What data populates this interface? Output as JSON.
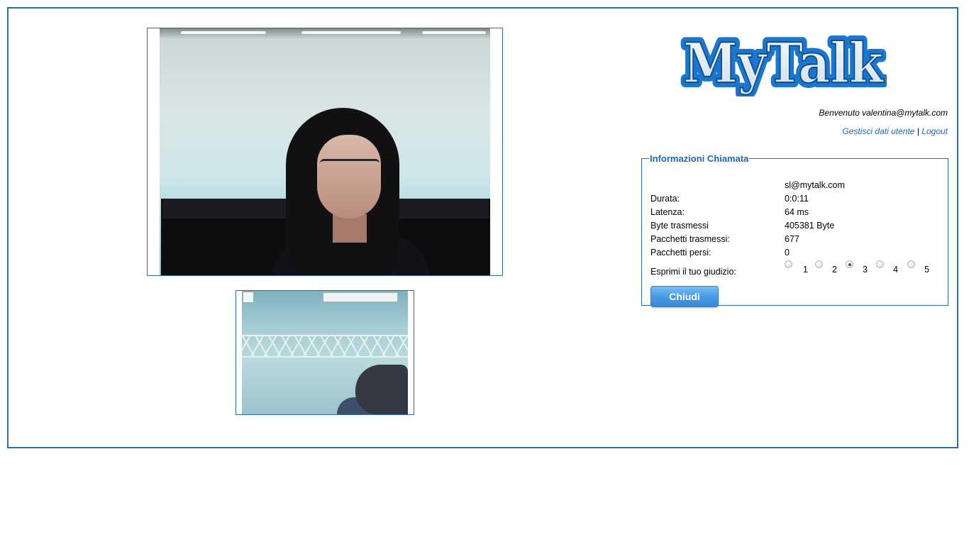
{
  "brand": {
    "logo_text": "MyTalk",
    "accent_color": "#1f67b1",
    "border_color": "#2a6fa4"
  },
  "header": {
    "welcome": "Benvenuto valentina@mytalk.com",
    "manage_link": "Gestisci dati utente",
    "separator": "|",
    "logout_link": "Logout"
  },
  "call_info": {
    "legend": "Informazioni Chiamata",
    "contact": "sl@mytalk.com",
    "rows": [
      {
        "label": "Durata:",
        "value": "0:0:11"
      },
      {
        "label": "Latenza:",
        "value": "64 ms"
      },
      {
        "label": "Byte trasmessi",
        "value": "405381 Byte"
      },
      {
        "label": "Pacchetti trasmessi:",
        "value": "677"
      },
      {
        "label": "Pacchetti persi:",
        "value": "0"
      }
    ],
    "rating_label": "Esprimi il tuo giudizio:",
    "rating_options": [
      "1",
      "2",
      "3",
      "4",
      "5"
    ],
    "rating_selected": "3",
    "close_button": "Chiudi"
  }
}
